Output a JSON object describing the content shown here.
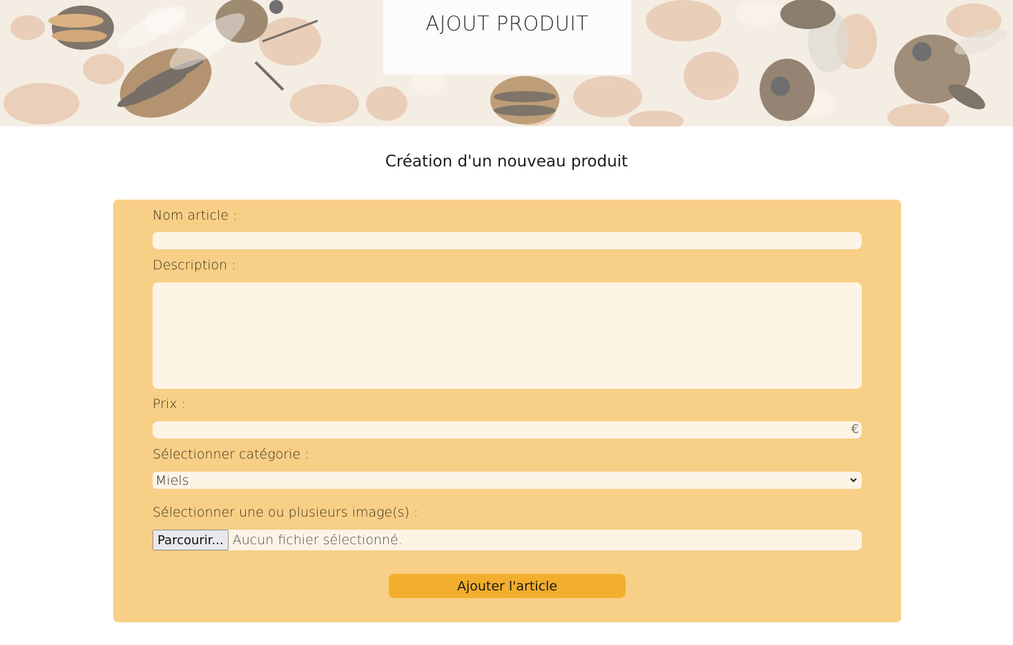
{
  "banner": {
    "title": "AJOUT PRODUIT"
  },
  "page": {
    "subtitle": "Création d'un nouveau produit"
  },
  "form": {
    "name_label": "Nom article :",
    "name_value": "",
    "description_label": "Description :",
    "description_value": "",
    "price_label": "Prix :",
    "price_value": "",
    "price_suffix": "€",
    "category_label": "Sélectionner catégorie :",
    "category_selected": "Miels",
    "images_label": "Sélectionner une ou plusieurs image(s) :",
    "browse_button": "Parcourir...",
    "file_status": "Aucun fichier sélectionné.",
    "submit_label": "Ajouter l'article"
  },
  "colors": {
    "panel_bg": "#f8cf86",
    "field_bg": "#fdf4e6",
    "submit_bg": "#f3ae2d"
  }
}
